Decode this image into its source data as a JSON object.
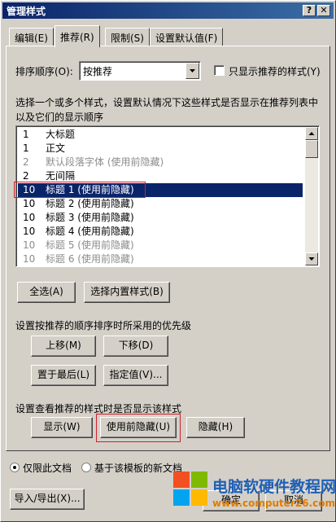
{
  "window": {
    "title": "管理样式",
    "help_label": "?",
    "close_label": "✕"
  },
  "tabs": [
    {
      "label": "编辑(E)",
      "active": false
    },
    {
      "label": "推荐(R)",
      "active": true
    },
    {
      "label": "限制(S)",
      "active": false
    },
    {
      "label": "设置默认值(F)",
      "active": false
    }
  ],
  "sort": {
    "label": "排序顺序(O):",
    "value": "按推荐",
    "show_only_label": "只显示推荐的样式(Y)"
  },
  "description": {
    "line1": "选择一个或多个样式，设置默认情况下这些样式是否显示在推荐列表中",
    "line2": "以及它们的显示顺序"
  },
  "styles_list": [
    {
      "num": "1",
      "name": "大标题",
      "dim": false,
      "selected": false
    },
    {
      "num": "1",
      "name": "正文",
      "dim": false,
      "selected": false
    },
    {
      "num": "2",
      "name": "默认段落字体 (使用前隐藏)",
      "dim": true,
      "selected": false
    },
    {
      "num": "2",
      "name": "无间隔",
      "dim": false,
      "selected": false
    },
    {
      "num": "10",
      "name": "标题 1 (使用前隐藏)",
      "dim": false,
      "selected": true
    },
    {
      "num": "10",
      "name": "标题 2 (使用前隐藏)",
      "dim": false,
      "selected": false
    },
    {
      "num": "10",
      "name": "标题 3 (使用前隐藏)",
      "dim": false,
      "selected": false
    },
    {
      "num": "10",
      "name": "标题 4 (使用前隐藏)",
      "dim": false,
      "selected": false
    },
    {
      "num": "10",
      "name": "标题 5 (使用前隐藏)",
      "dim": true,
      "selected": false
    },
    {
      "num": "10",
      "name": "标题 6 (使用前隐藏)",
      "dim": true,
      "selected": false
    }
  ],
  "select_buttons": {
    "select_all": "全选(A)",
    "select_builtin": "选择内置样式(B)"
  },
  "priority": {
    "label": "设置按推荐的顺序排序时所采用的优先级",
    "move_up": "上移(M)",
    "move_down": "下移(D)",
    "move_last": "置于最后(L)",
    "assign_value": "指定值(V)..."
  },
  "visibility": {
    "label": "设置查看推荐的样式时是否显示该样式",
    "show": "显示(W)",
    "hide_until_used": "使用前隐藏(U)",
    "hide": "隐藏(H)"
  },
  "scope": {
    "this_doc": "仅限此文档",
    "new_docs": "基于该模板的新文档"
  },
  "footer": {
    "import_export": "导入/导出(X)...",
    "ok": "确定",
    "cancel": "取消"
  },
  "watermark": {
    "name": "电脑软硬件教程网",
    "url": "www.computer26.com"
  },
  "colors": {
    "selection": "#0a246a",
    "highlight_box": "#d0202a"
  }
}
